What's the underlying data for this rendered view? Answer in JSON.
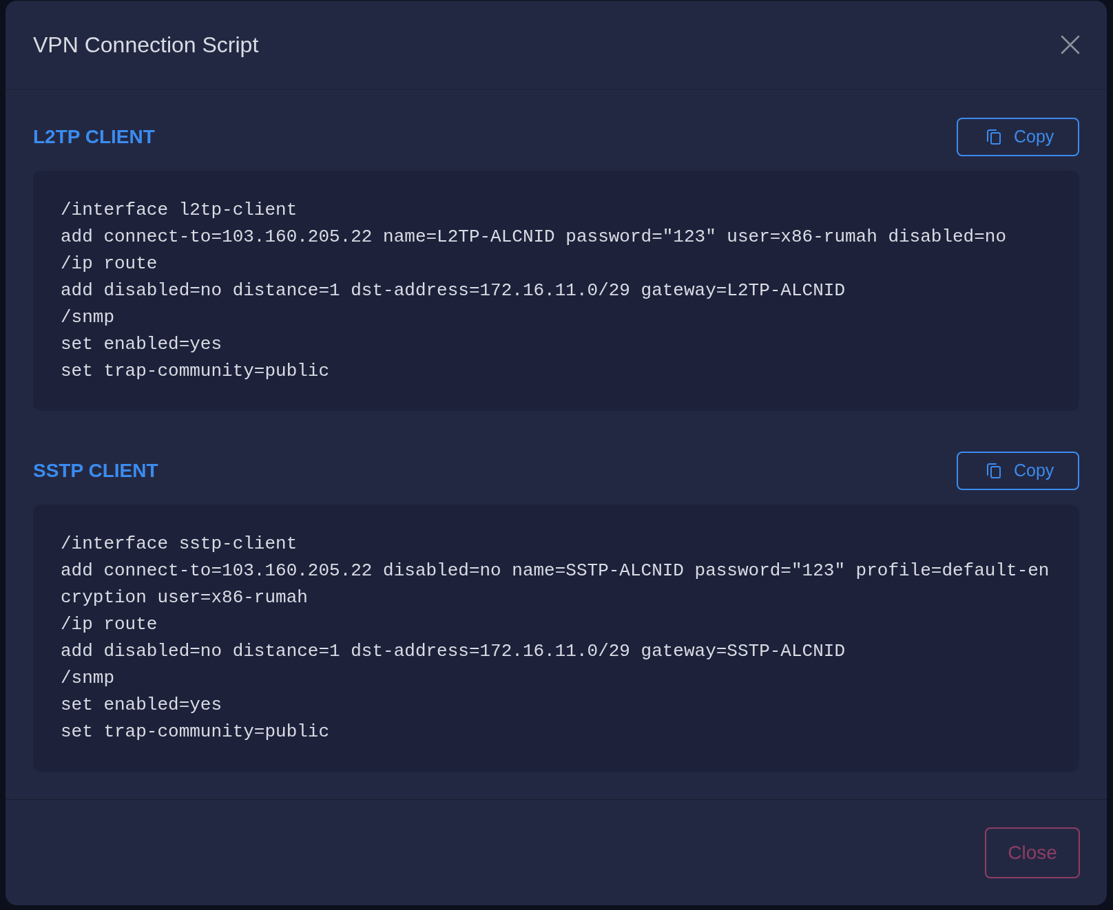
{
  "dialog": {
    "title": "VPN Connection Script"
  },
  "sections": [
    {
      "title": "L2TP CLIENT",
      "copy_button": "Copy",
      "code_lines": [
        "/interface l2tp-client",
        "add connect-to=103.160.205.22 name=L2TP-ALCNID password=\"123\" user=x86-rumah disabled=no",
        "/ip route",
        "add disabled=no distance=1 dst-address=172.16.11.0/29 gateway=L2TP-ALCNID",
        "/snmp",
        "set enabled=yes",
        "set trap-community=public"
      ]
    },
    {
      "title": "SSTP CLIENT",
      "copy_button": "Copy",
      "code_lines": [
        "/interface sstp-client",
        "add connect-to=103.160.205.22 disabled=no name=SSTP-ALCNID password=\"123\" profile=default-encryption user=x86-rumah",
        "/ip route",
        "add disabled=no distance=1 dst-address=172.16.11.0/29 gateway=SSTP-ALCNID",
        "/snmp",
        "set enabled=yes",
        "set trap-community=public"
      ]
    }
  ],
  "footer": {
    "buttons": [
      {
        "label": "Close",
        "kind": "close"
      }
    ]
  }
}
